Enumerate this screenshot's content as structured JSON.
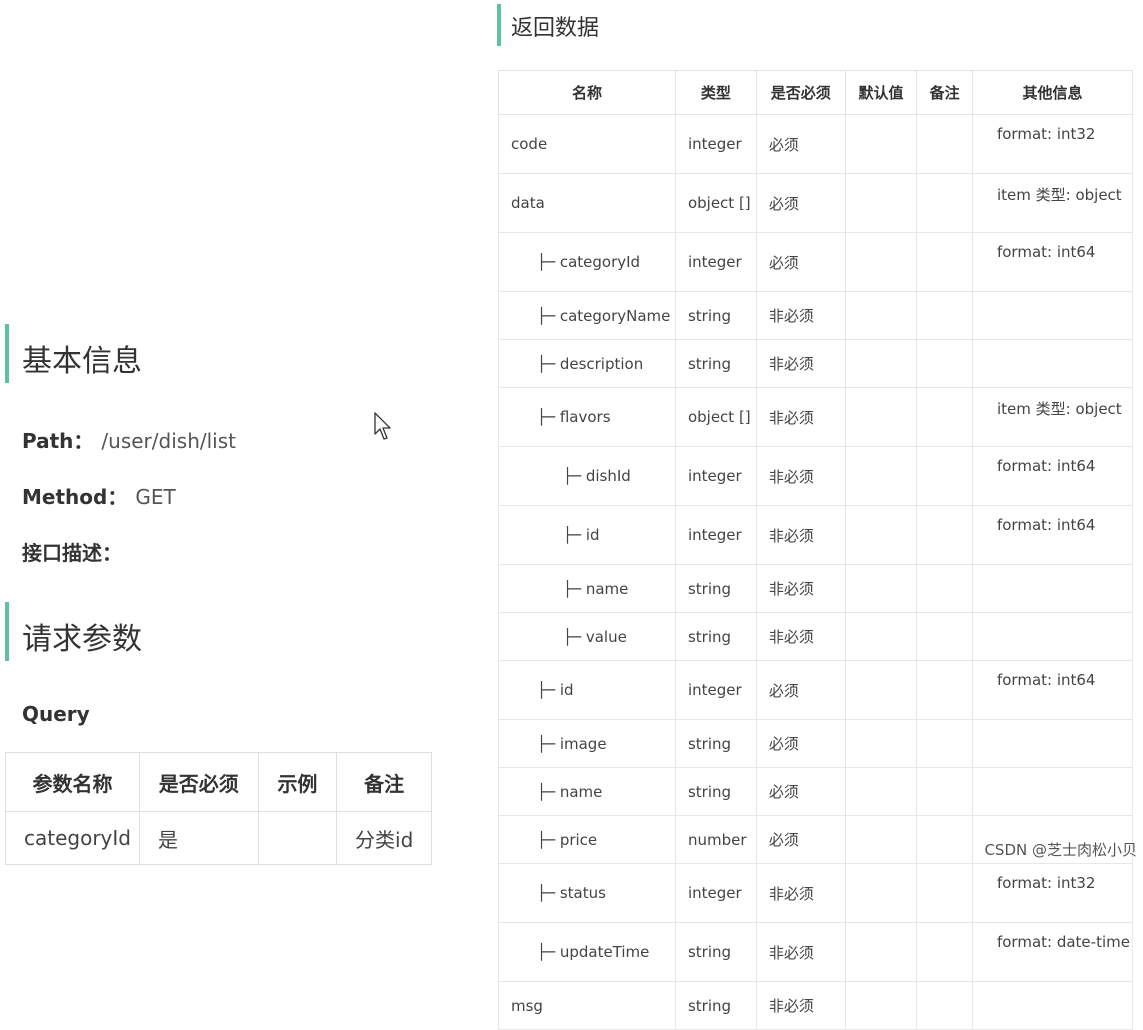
{
  "left": {
    "basic_info_title": "基本信息",
    "path_label": "Path：",
    "path_value": "/user/dish/list",
    "method_label": "Method：",
    "method_value": "GET",
    "desc_label": "接口描述：",
    "request_title": "请求参数",
    "query_label": "Query",
    "query_table": {
      "headers": [
        "参数名称",
        "是否必须",
        "示例",
        "备注"
      ],
      "rows": [
        [
          "categoryId",
          "是",
          "",
          "分类id"
        ]
      ]
    }
  },
  "right": {
    "title": "返回数据",
    "table": {
      "headers": [
        "名称",
        "类型",
        "是否必须",
        "默认值",
        "备注",
        "其他信息"
      ],
      "rows": [
        {
          "name": "code",
          "type": "integer",
          "required": "必须",
          "default": "",
          "note": "",
          "other": "format: int32"
        },
        {
          "name": "data",
          "type": "object []",
          "required": "必须",
          "default": "",
          "note": "",
          "other": "item 类型: object"
        },
        {
          "name": "├─ categoryId",
          "type": "integer",
          "required": "必须",
          "default": "",
          "note": "",
          "other": "format: int64"
        },
        {
          "name": "├─ categoryName",
          "type": "string",
          "required": "非必须",
          "default": "",
          "note": "",
          "other": ""
        },
        {
          "name": "├─ description",
          "type": "string",
          "required": "非必须",
          "default": "",
          "note": "",
          "other": ""
        },
        {
          "name": "├─ flavors",
          "type": "object []",
          "required": "非必须",
          "default": "",
          "note": "",
          "other": "item 类型: object"
        },
        {
          "name": "├─ dishId",
          "type": "integer",
          "required": "非必须",
          "default": "",
          "note": "",
          "other": "format: int64"
        },
        {
          "name": "├─ id",
          "type": "integer",
          "required": "非必须",
          "default": "",
          "note": "",
          "other": "format: int64"
        },
        {
          "name": "├─ name",
          "type": "string",
          "required": "非必须",
          "default": "",
          "note": "",
          "other": ""
        },
        {
          "name": "├─ value",
          "type": "string",
          "required": "非必须",
          "default": "",
          "note": "",
          "other": ""
        },
        {
          "name": "├─ id",
          "type": "integer",
          "required": "必须",
          "default": "",
          "note": "",
          "other": "format: int64"
        },
        {
          "name": "├─ image",
          "type": "string",
          "required": "必须",
          "default": "",
          "note": "",
          "other": ""
        },
        {
          "name": "├─ name",
          "type": "string",
          "required": "必须",
          "default": "",
          "note": "",
          "other": ""
        },
        {
          "name": "├─ price",
          "type": "number",
          "required": "必须",
          "default": "",
          "note": "",
          "other": ""
        },
        {
          "name": "├─ status",
          "type": "integer",
          "required": "非必须",
          "default": "",
          "note": "",
          "other": "format: int32"
        },
        {
          "name": "├─ updateTime",
          "type": "string",
          "required": "非必须",
          "default": "",
          "note": "",
          "other": "format: date-time"
        },
        {
          "name": "msg",
          "type": "string",
          "required": "非必须",
          "default": "",
          "note": "",
          "other": ""
        }
      ]
    }
  },
  "watermark": "CSDN @芝士肉松小贝",
  "colors": {
    "accent_bar": "#5cc39c"
  }
}
